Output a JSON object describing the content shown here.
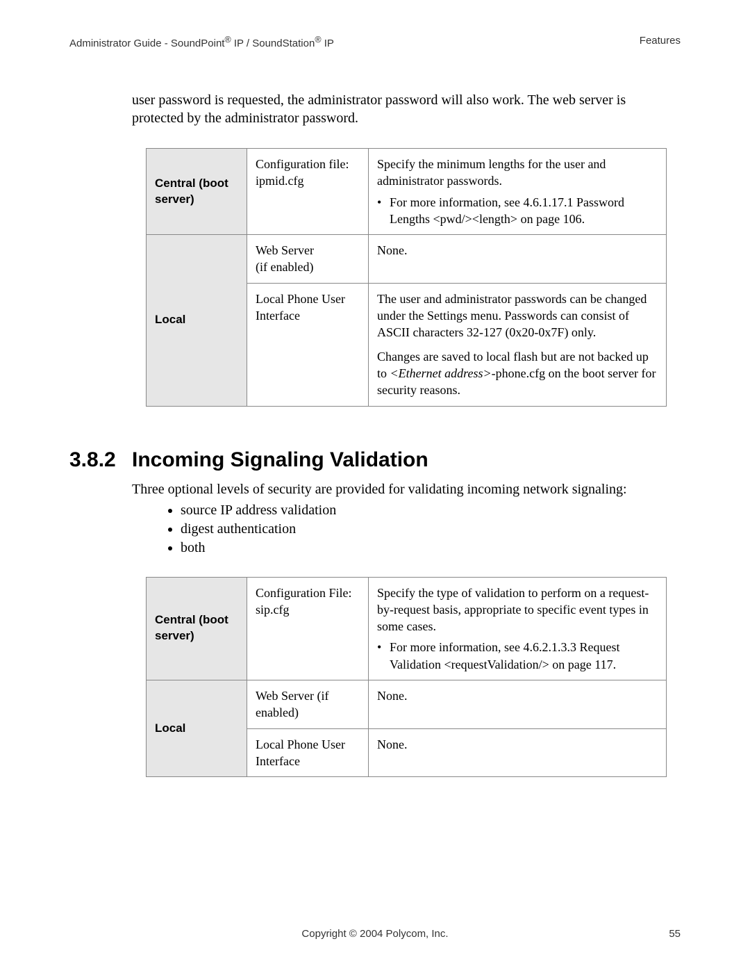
{
  "header": {
    "left_prefix": "Administrator Guide - SoundPoint",
    "left_mid": " IP / SoundStation",
    "left_suffix": " IP",
    "reg": "®",
    "right": "Features"
  },
  "intro": "user password is requested, the administrator password will also work.  The web server is protected by the administrator password.",
  "table1": {
    "r1": {
      "label": "Central (boot server)",
      "col2_l1": "Configuration file:",
      "col2_l2": "ipmid.cfg",
      "col3_p": "Specify the minimum lengths for the user and administrator passwords.",
      "col3_b": "For more information, see 4.6.1.17.1 Password Lengths <pwd/><length> on page 106."
    },
    "r2": {
      "label": "Local",
      "c1_col2_l1": "Web Server",
      "c1_col2_l2": "(if enabled)",
      "c1_col3": "None.",
      "c2_col2_l1": "Local Phone User",
      "c2_col2_l2": "Interface",
      "c2_col3_p1": "The user and administrator passwords can be changed under the Settings menu.  Passwords can consist of ASCII characters 32-127 (0x20-0x7F) only.",
      "c2_col3_p2a": "Changes are saved to local flash but are not backed up to ",
      "c2_col3_p2i": "<Ethernet address>",
      "c2_col3_p2b": "-phone.cfg on the boot server for security reasons."
    }
  },
  "section": {
    "num": "3.8.2",
    "title": "Incoming Signaling Validation",
    "para": "Three optional levels of security are provided for validating incoming network signaling:",
    "items": [
      "source IP address validation",
      "digest authentication",
      "both"
    ]
  },
  "table2": {
    "r1": {
      "label": "Central (boot server)",
      "col2_l1": "Configuration File:",
      "col2_l2": "sip.cfg",
      "col3_p": "Specify the type of validation to perform on a request-by-request basis, appropriate to specific event types in some cases.",
      "col3_b": "For more information, see 4.6.2.1.3.3 Request Validation <requestValidation/> on page 117."
    },
    "r2": {
      "label": "Local",
      "c1_col2": "Web Server (if enabled)",
      "c1_col3": "None.",
      "c2_col2_l1": "Local Phone User",
      "c2_col2_l2": "Interface",
      "c2_col3": "None."
    }
  },
  "footer": {
    "center": "Copyright © 2004 Polycom, Inc.",
    "page": "55"
  }
}
